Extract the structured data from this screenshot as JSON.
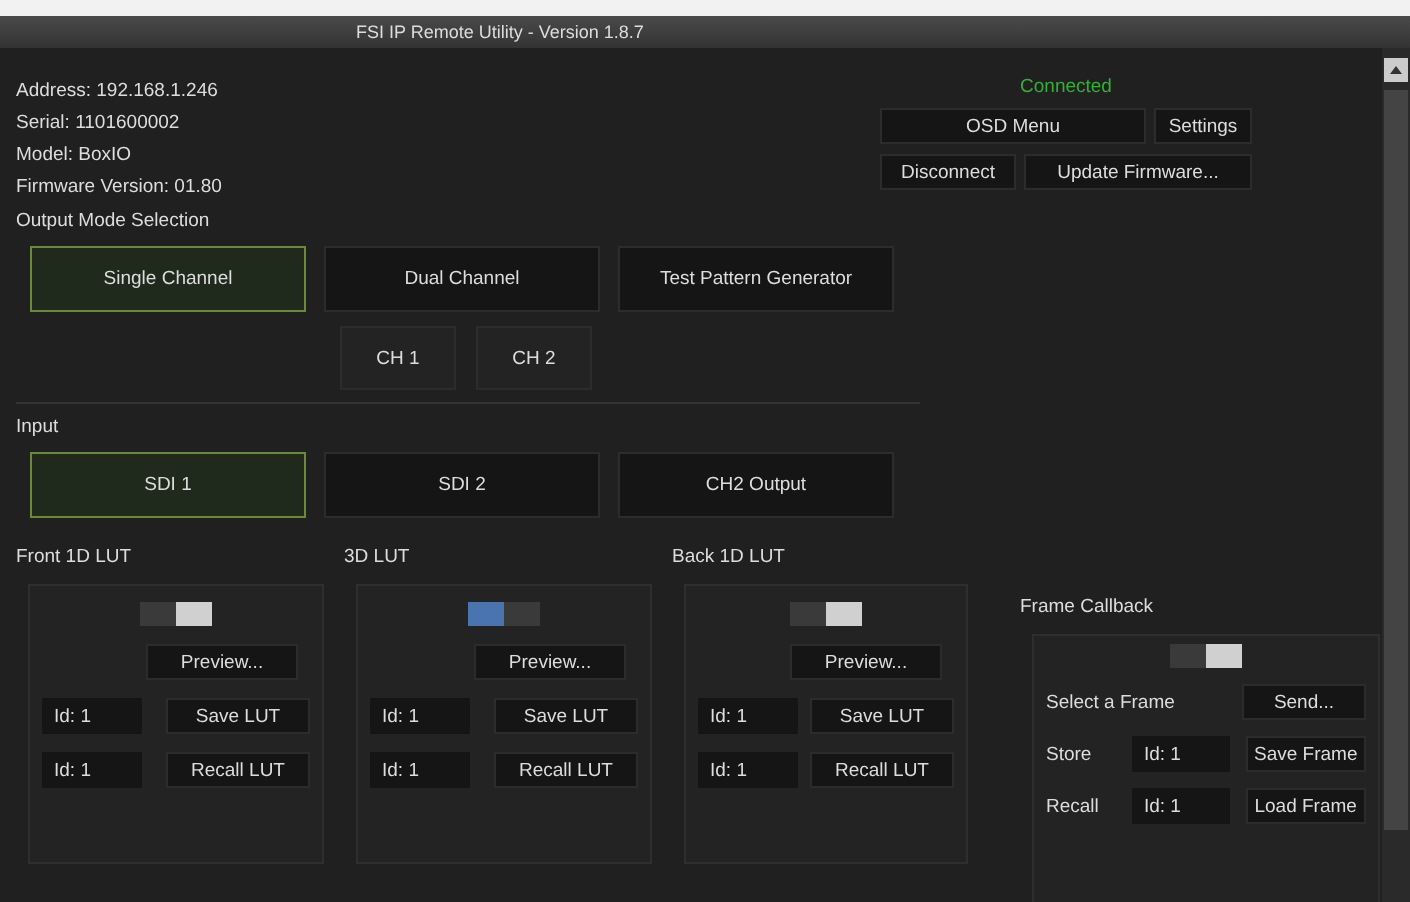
{
  "window": {
    "title": "FSI IP Remote Utility - Version 1.8.7"
  },
  "device_info": [
    "Address: 192.168.1.246",
    "Serial: 1101600002",
    "Model: BoxIO",
    "Firmware Version: 01.80"
  ],
  "status": "Connected",
  "top_buttons": [
    [
      "OSD Menu",
      "Settings"
    ],
    [
      "Disconnect",
      "Update Firmware..."
    ]
  ],
  "output_mode": {
    "label": "Output Mode Selection",
    "modes": [
      {
        "label": "Single Channel",
        "selected": true
      },
      {
        "label": "Dual Channel",
        "selected": false
      },
      {
        "label": "Test Pattern Generator",
        "selected": false
      }
    ],
    "channels": [
      "CH 1",
      "CH 2"
    ]
  },
  "input": {
    "label": "Input",
    "options": [
      {
        "label": "SDI 1",
        "selected": true
      },
      {
        "label": "SDI 2",
        "selected": false
      },
      {
        "label": "CH2 Output",
        "selected": false
      }
    ]
  },
  "luts": [
    {
      "title": "Front 1D LUT",
      "on": false,
      "preview": "Preview...",
      "rows": [
        {
          "id": "Id: 1",
          "action": "Save LUT"
        },
        {
          "id": "Id: 1",
          "action": "Recall LUT"
        }
      ]
    },
    {
      "title": "3D LUT",
      "on": true,
      "preview": "Preview...",
      "rows": [
        {
          "id": "Id: 1",
          "action": "Save LUT"
        },
        {
          "id": "Id: 1",
          "action": "Recall LUT"
        }
      ]
    },
    {
      "title": "Back 1D LUT",
      "on": false,
      "preview": "Preview...",
      "rows": [
        {
          "id": "Id: 1",
          "action": "Save LUT"
        },
        {
          "id": "Id: 1",
          "action": "Recall LUT"
        }
      ]
    }
  ],
  "frame_callback": {
    "title": "Frame Callback",
    "on": false,
    "select_label": "Select a Frame",
    "send": "Send...",
    "rows": [
      {
        "label": "Store",
        "id": "Id: 1",
        "action": "Save Frame"
      },
      {
        "label": "Recall",
        "id": "Id: 1",
        "action": "Load Frame"
      }
    ]
  }
}
